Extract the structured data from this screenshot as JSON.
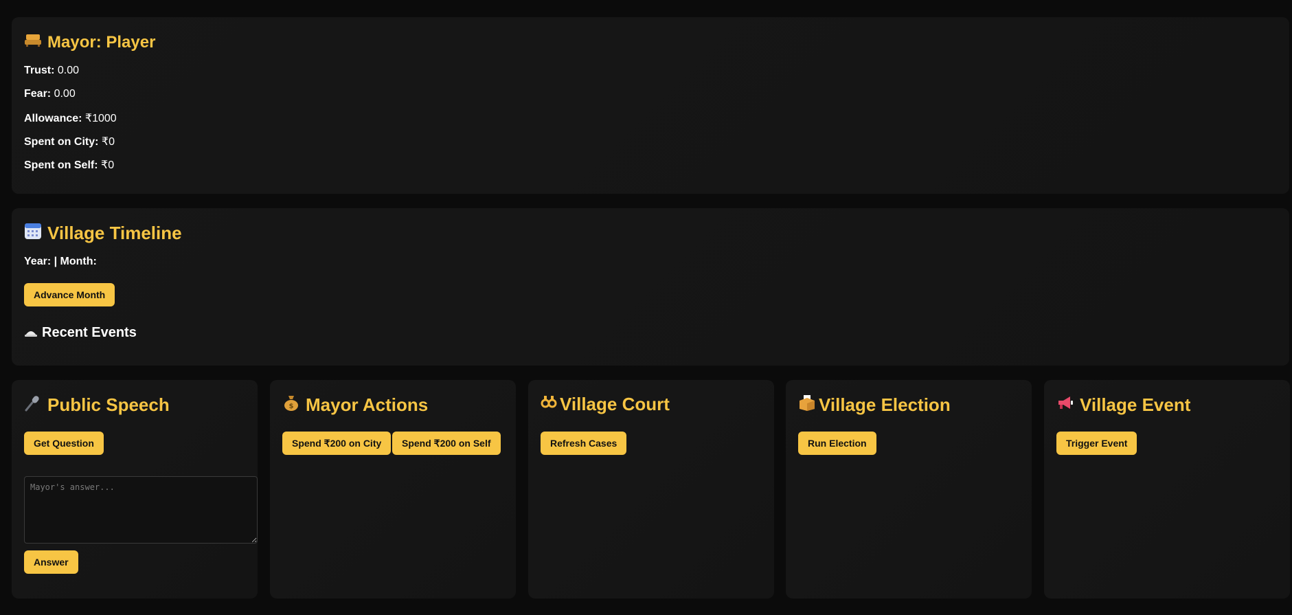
{
  "mayor": {
    "icon": "mayor-seat-icon",
    "title": "Mayor: Player",
    "stats": [
      {
        "label": "Trust:",
        "value": "0.00"
      },
      {
        "label": "Fear:",
        "value": "0.00"
      },
      {
        "label": "Allowance:",
        "value": "₹1000"
      },
      {
        "label": "Spent on City:",
        "value": "₹0"
      },
      {
        "label": "Spent on Self:",
        "value": "₹0"
      }
    ]
  },
  "timeline": {
    "icon": "calendar-icon",
    "title": "Village Timeline",
    "year_month_label": "Year: | Month:",
    "advance_button": "Advance Month",
    "recent_icon": "news-icon",
    "recent_heading": "Recent Events"
  },
  "speech": {
    "icon": "microphone-icon",
    "title": "Public Speech",
    "get_question_button": "Get Question",
    "answer_placeholder": "Mayor's answer...",
    "answer_button": "Answer"
  },
  "actions": {
    "icon": "money-bag-icon",
    "title": "Mayor Actions",
    "spend_city_button": "Spend ₹200 on City",
    "spend_self_button": "Spend ₹200 on Self"
  },
  "court": {
    "icon": "handcuffs-icon",
    "title": "Village Court",
    "refresh_button": "Refresh Cases"
  },
  "election": {
    "icon": "ballot-box-icon",
    "title": "Village Election",
    "run_button": "Run Election"
  },
  "event": {
    "icon": "megaphone-icon",
    "title": "Village Event",
    "trigger_button": "Trigger Event"
  },
  "colors": {
    "accent": "#f7c544",
    "background": "#0b0b0b",
    "card": "#161616"
  }
}
